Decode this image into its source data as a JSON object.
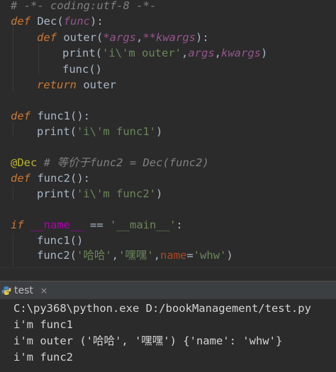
{
  "editor": {
    "lines": [
      {
        "comment": "# -*- coding:utf-8 -*-"
      },
      {
        "kw": "def",
        "name": " Dec(",
        "param": "func",
        "rest": "):"
      },
      {
        "kw": "def",
        "name": " outer(",
        "p1": "*args",
        "sep": ",",
        "p2": "**kwargs",
        "rest": "):"
      },
      {
        "pre": "print(",
        "str": "'i\\'m outer'",
        "mid": ",",
        "a1": "args",
        "c": ",",
        "a2": "kwargs",
        "rest": ")"
      },
      {
        "text": "func()"
      },
      {
        "kw": "return",
        "rest": " outer"
      },
      {
        "kw": "def",
        "rest": " func1():"
      },
      {
        "pre": "print(",
        "str": "'i\\'m func1'",
        "rest": ")"
      },
      {
        "dec": "@Dec",
        "comment": " # 等价于func2 = Dec(func2)"
      },
      {
        "kw": "def",
        "rest": " func2():"
      },
      {
        "pre": "print(",
        "str": "'i\\'m func2'",
        "rest": ")"
      },
      {
        "kw": "if",
        "dn": " __name__",
        "op": " == ",
        "str": "'__main__'",
        "rest": ":"
      },
      {
        "text": "func1()"
      },
      {
        "pre": "func2(",
        "s1": "'哈哈'",
        "c": ",",
        "s2": "'嘿嘿'",
        "c2": ",",
        "kwn": "name",
        "eq": "=",
        "s3": "'whw'",
        "rest": ")"
      }
    ]
  },
  "run_tab": {
    "label": "test",
    "close": "×"
  },
  "console": {
    "lines": [
      "C:\\py368\\python.exe D:/bookManagement/test.py",
      "i'm func1",
      "i'm outer ('哈哈', '嘿嘿') {'name': 'whw'}",
      "i'm func2"
    ]
  },
  "colors": {
    "background": "#2b2b2b",
    "keyword": "#cc7832",
    "string": "#6a8759",
    "comment": "#808080",
    "decorator": "#bbb529",
    "param": "#94558d"
  }
}
